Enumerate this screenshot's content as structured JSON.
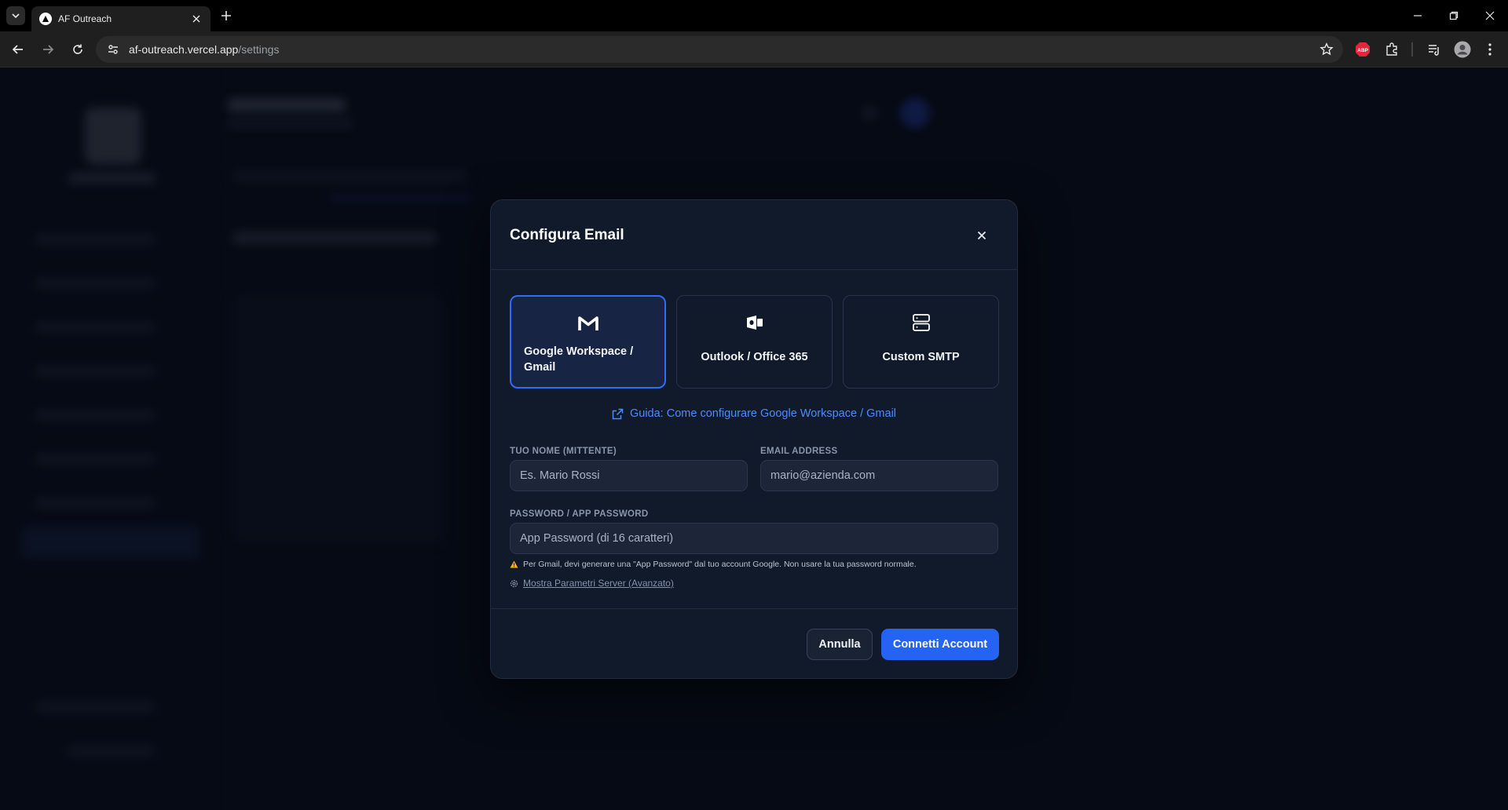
{
  "browser": {
    "tab_title": "AF Outreach",
    "url_host": "af-outreach.vercel.app",
    "url_path": "/settings",
    "abp_label": "ABP"
  },
  "modal": {
    "title": "Configura Email",
    "providers": [
      {
        "label": "Google Workspace / Gmail",
        "icon": "gmail-icon",
        "selected": true
      },
      {
        "label": "Outlook / Office 365",
        "icon": "outlook-icon",
        "selected": false
      },
      {
        "label": "Custom SMTP",
        "icon": "server-icon",
        "selected": false
      }
    ],
    "guide_link": "Guida: Come configurare Google Workspace / Gmail",
    "fields": {
      "name_label": "TUO NOME (MITTENTE)",
      "name_placeholder": "Es. Mario Rossi",
      "email_label": "EMAIL ADDRESS",
      "email_placeholder": "mario@azienda.com",
      "password_label": "PASSWORD / APP PASSWORD",
      "password_placeholder": "App Password (di 16 caratteri)"
    },
    "warning": "Per Gmail, devi generare una \"App Password\" dal tuo account Google. Non usare la tua password normale.",
    "advanced_link": "Mostra Parametri Server (Avanzato)",
    "cancel_button": "Annulla",
    "connect_button": "Connetti Account"
  },
  "colors": {
    "accent": "#2563f2",
    "link": "#4b8bff",
    "modal_bg": "#111a2b",
    "warning": "#f5b301"
  }
}
